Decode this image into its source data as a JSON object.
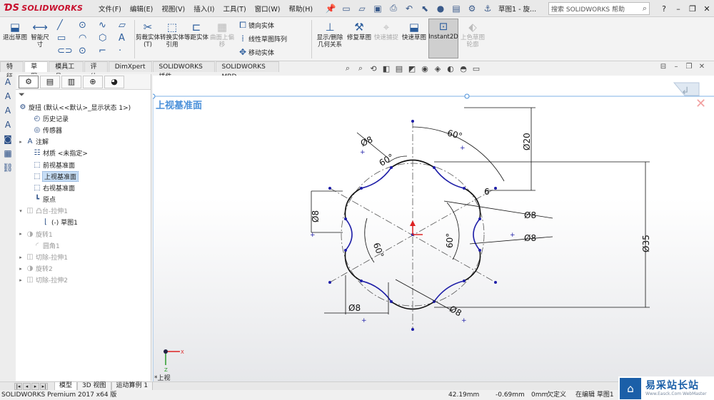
{
  "app": {
    "brand": "SOLIDWORKS",
    "title": "草图1 - 旋..."
  },
  "menus": [
    "文件(F)",
    "编辑(E)",
    "视图(V)",
    "插入(I)",
    "工具(T)",
    "窗口(W)",
    "帮助(H)"
  ],
  "search": {
    "placeholder": "搜索 SOLIDWORKS 帮助"
  },
  "ribbon": {
    "exit_sketch": "退出草图",
    "smart_dim": "智能尺寸",
    "trim": "剪裁实体(T)",
    "convert": "转换实体引用",
    "offset": "等距实体",
    "surface_offset": "曲面上偏移",
    "mirror": "镜向实体",
    "linear_pattern": "线性草图阵列",
    "move": "移动实体",
    "display_relations": "显示/删除几何关系",
    "repair": "修复草图",
    "quick_snap": "快速捕捉",
    "rapid_sketch": "快速草图",
    "instant2d": "Instant2D",
    "shaded_sketch": "上色草图轮廓"
  },
  "cmd_tabs": [
    "特征",
    "草图",
    "模具工具",
    "评估",
    "DimXpert",
    "SOLIDWORKS 插件",
    "SOLIDWORKS MBD"
  ],
  "fm_tree": {
    "root": "旋扭 (默认<<默认>_显示状态 1>)",
    "history": "历史记录",
    "sensors": "传感器",
    "annotations": "注解",
    "material": "材质 <未指定>",
    "front_plane": "前视基准面",
    "top_plane": "上视基准面",
    "right_plane": "右视基准面",
    "origin": "原点",
    "boss_extrude": "凸台-拉伸1",
    "sketch1": "(-) 草图1",
    "revolve1": "旋转1",
    "fillet1": "圆角1",
    "cut_extrude1": "切除-拉伸1",
    "revolve2": "旋转2",
    "cut_extrude2": "切除-拉伸2"
  },
  "graphics": {
    "plane_label": "上视基准面",
    "view_label": "*上视",
    "dims": {
      "d8_top": "Ø8",
      "a60_top": "60°",
      "a60_inner": "60°",
      "d20": "Ø20",
      "r6": "6",
      "d8_left": "Ø8",
      "d8_right1": "Ø8",
      "d8_right2": "Ø8",
      "a60_right": "60°",
      "d35": "Ø35",
      "a60_left": "60°",
      "d8_bottom": "Ø8",
      "d8_bottom_right": "Ø8"
    }
  },
  "bottom_tabs": [
    "模型",
    "3D 视图",
    "运动算例 1"
  ],
  "status": {
    "product": "SOLIDWORKS Premium 2017 x64 版",
    "x": "42.19mm",
    "y": "-0.69mm",
    "z": "0mm",
    "defined": "欠定义",
    "editing": "在编辑 草图1"
  },
  "watermark": {
    "main": "易采站长站",
    "sub": "Www.Easck.Com  WebMaster"
  },
  "colors": {
    "brand_red": "#c8102e",
    "sketch_blue": "#1f1fa8",
    "plane_blue": "#4a90d9",
    "selection": "#c7def5"
  }
}
